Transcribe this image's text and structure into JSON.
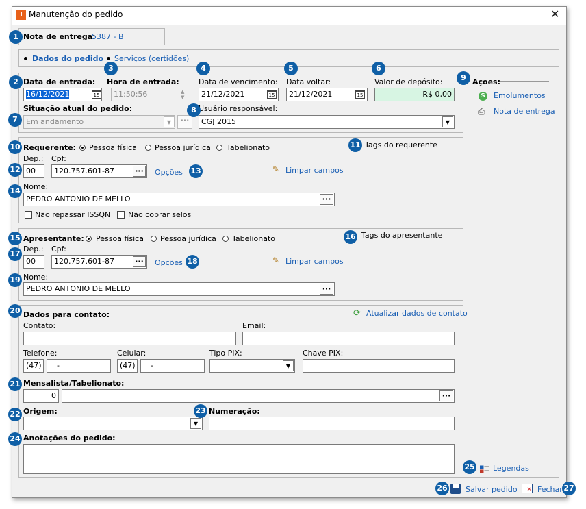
{
  "window": {
    "title": "Manutenção do pedido",
    "app_icon": "I"
  },
  "nota": {
    "label": "Nota de entrega:",
    "value": "5387 - B"
  },
  "tabs": {
    "dados": "Dados do pedido",
    "servicos": "Serviços (certidões)"
  },
  "pedido": {
    "data_entrada_label": "Data de entrada:",
    "data_entrada": "16/12/2021",
    "hora_entrada_label": "Hora de entrada:",
    "hora_entrada": "11:50:56",
    "vencimento_label": "Data de vencimento:",
    "vencimento": "21/12/2021",
    "voltar_label": "Data voltar:",
    "voltar": "21/12/2021",
    "deposito_label": "Valor de depósito:",
    "deposito": "R$ 0,00",
    "situacao_label": "Situação atual do pedido:",
    "situacao": "Em andamento",
    "usuario_label": "Usuário responsável:",
    "usuario": "CGJ 2015"
  },
  "acoes": {
    "title": "Ações:",
    "emolumentos": "Emolumentos",
    "nota_entrega": "Nota de entrega"
  },
  "requerente": {
    "label": "Requerente:",
    "fisica": "Pessoa física",
    "juridica": "Pessoa jurídica",
    "tabelionato": "Tabelionato",
    "tags": "Tags do requerente",
    "dep_label": "Dep.:",
    "dep": "00",
    "cpf_label": "Cpf:",
    "cpf": "120.757.601-87",
    "opcoes": "Opções",
    "limpar": "Limpar campos",
    "nome_label": "Nome:",
    "nome": "PEDRO ANTONIO DE MELLO",
    "nao_repassar": "Não repassar ISSQN",
    "nao_cobrar": "Não cobrar selos"
  },
  "apresentante": {
    "label": "Apresentante:",
    "fisica": "Pessoa física",
    "juridica": "Pessoa jurídica",
    "tabelionato": "Tabelionato",
    "tags": "Tags do apresentante",
    "dep_label": "Dep.:",
    "dep": "00",
    "cpf_label": "Cpf:",
    "cpf": "120.757.601-87",
    "opcoes": "Opções",
    "limpar": "Limpar campos",
    "nome_label": "Nome:",
    "nome": "PEDRO ANTONIO DE MELLO"
  },
  "contato": {
    "title": "Dados para contato:",
    "atualizar": "Atualizar dados de contato",
    "contato_label": "Contato:",
    "email_label": "Email:",
    "telefone_label": "Telefone:",
    "tel_ddd": "(47)",
    "tel_num": "-",
    "celular_label": "Celular:",
    "cel_ddd": "(47)",
    "cel_num": "-",
    "pix_tipo_label": "Tipo PIX:",
    "pix_chave_label": "Chave PIX:"
  },
  "mensalista": {
    "label": "Mensalista/Tabelionato:",
    "code": "0"
  },
  "origem": {
    "label": "Origem:"
  },
  "numeracao": {
    "label": "Numeração:"
  },
  "anotacoes": {
    "label": "Anotações do pedido:"
  },
  "legendas": "Legendas",
  "footer": {
    "salvar": "Salvar pedido",
    "fechar": "Fechar"
  },
  "badges": [
    "1",
    "2",
    "3",
    "4",
    "5",
    "6",
    "7",
    "8",
    "9",
    "10",
    "11",
    "12",
    "13",
    "14",
    "15",
    "16",
    "17",
    "18",
    "19",
    "20",
    "21",
    "22",
    "23",
    "24",
    "25",
    "26",
    "27"
  ],
  "colors": {
    "badge": "#0f5fa6",
    "link": "#1a5fb4",
    "deposit_bg": "#d7f5e3",
    "app_icon": "#e8611a"
  }
}
